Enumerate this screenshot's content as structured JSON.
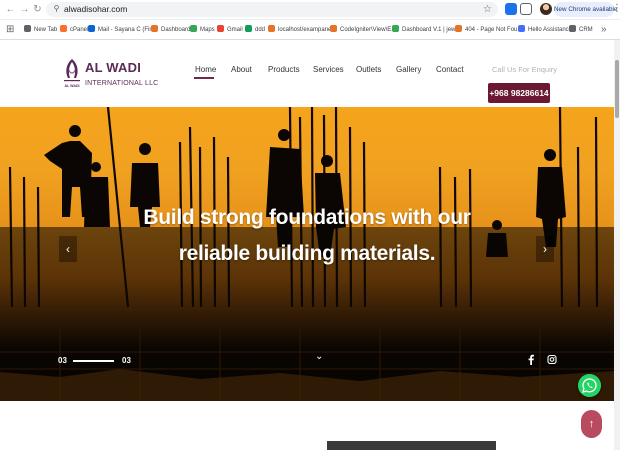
{
  "browser": {
    "url": "alwadisohar.com",
    "new_chrome_label": "New Chrome available",
    "bookmarks": [
      {
        "label": "New Tab",
        "color": "#5f6368"
      },
      {
        "label": "cPanel",
        "color": "#ff6c2c"
      },
      {
        "label": "Mail - Sayana C (Fin...",
        "color": "#0a64d6"
      },
      {
        "label": "Dashboard",
        "color": "#e8722a"
      },
      {
        "label": "Maps",
        "color": "#34a853"
      },
      {
        "label": "Gmail",
        "color": "#ea4335"
      },
      {
        "label": "ddd",
        "color": "#0f9d58"
      },
      {
        "label": "localhost/exampane...",
        "color": "#e8722a"
      },
      {
        "label": "CodeIgniter\\View\\E...",
        "color": "#e8722a"
      },
      {
        "label": "Dashboard V.1 | jew...",
        "color": "#34a853"
      },
      {
        "label": "404 - Page Not Fou...",
        "color": "#e8722a"
      },
      {
        "label": "Hello Assistance",
        "color": "#4a6cf7"
      },
      {
        "label": "CRM",
        "color": "#5f6368"
      }
    ]
  },
  "site": {
    "logo": {
      "title": "AL WADI",
      "subtitle": "INTERNATIONAL LLC",
      "mark_text": "AL WADI"
    },
    "nav": [
      "Home",
      "About",
      "Products",
      "Services",
      "Outlets",
      "Gallery",
      "Contact"
    ],
    "enquiry_label": "Call Us For Enquiry",
    "phone": "+968 98286614",
    "colors": {
      "brand": "#5b2b55",
      "phone_button": "#6b1832",
      "whatsapp": "#25d366",
      "back_to_top": "#b94b60"
    }
  },
  "hero": {
    "headline_line1": "Build strong foundations with our",
    "headline_line2": "reliable building materials.",
    "slide_current": "03",
    "slide_total": "03",
    "prev_icon": "‹",
    "next_icon": "›",
    "scroll_icon": "⌄",
    "social": [
      "facebook-icon",
      "instagram-icon"
    ]
  }
}
